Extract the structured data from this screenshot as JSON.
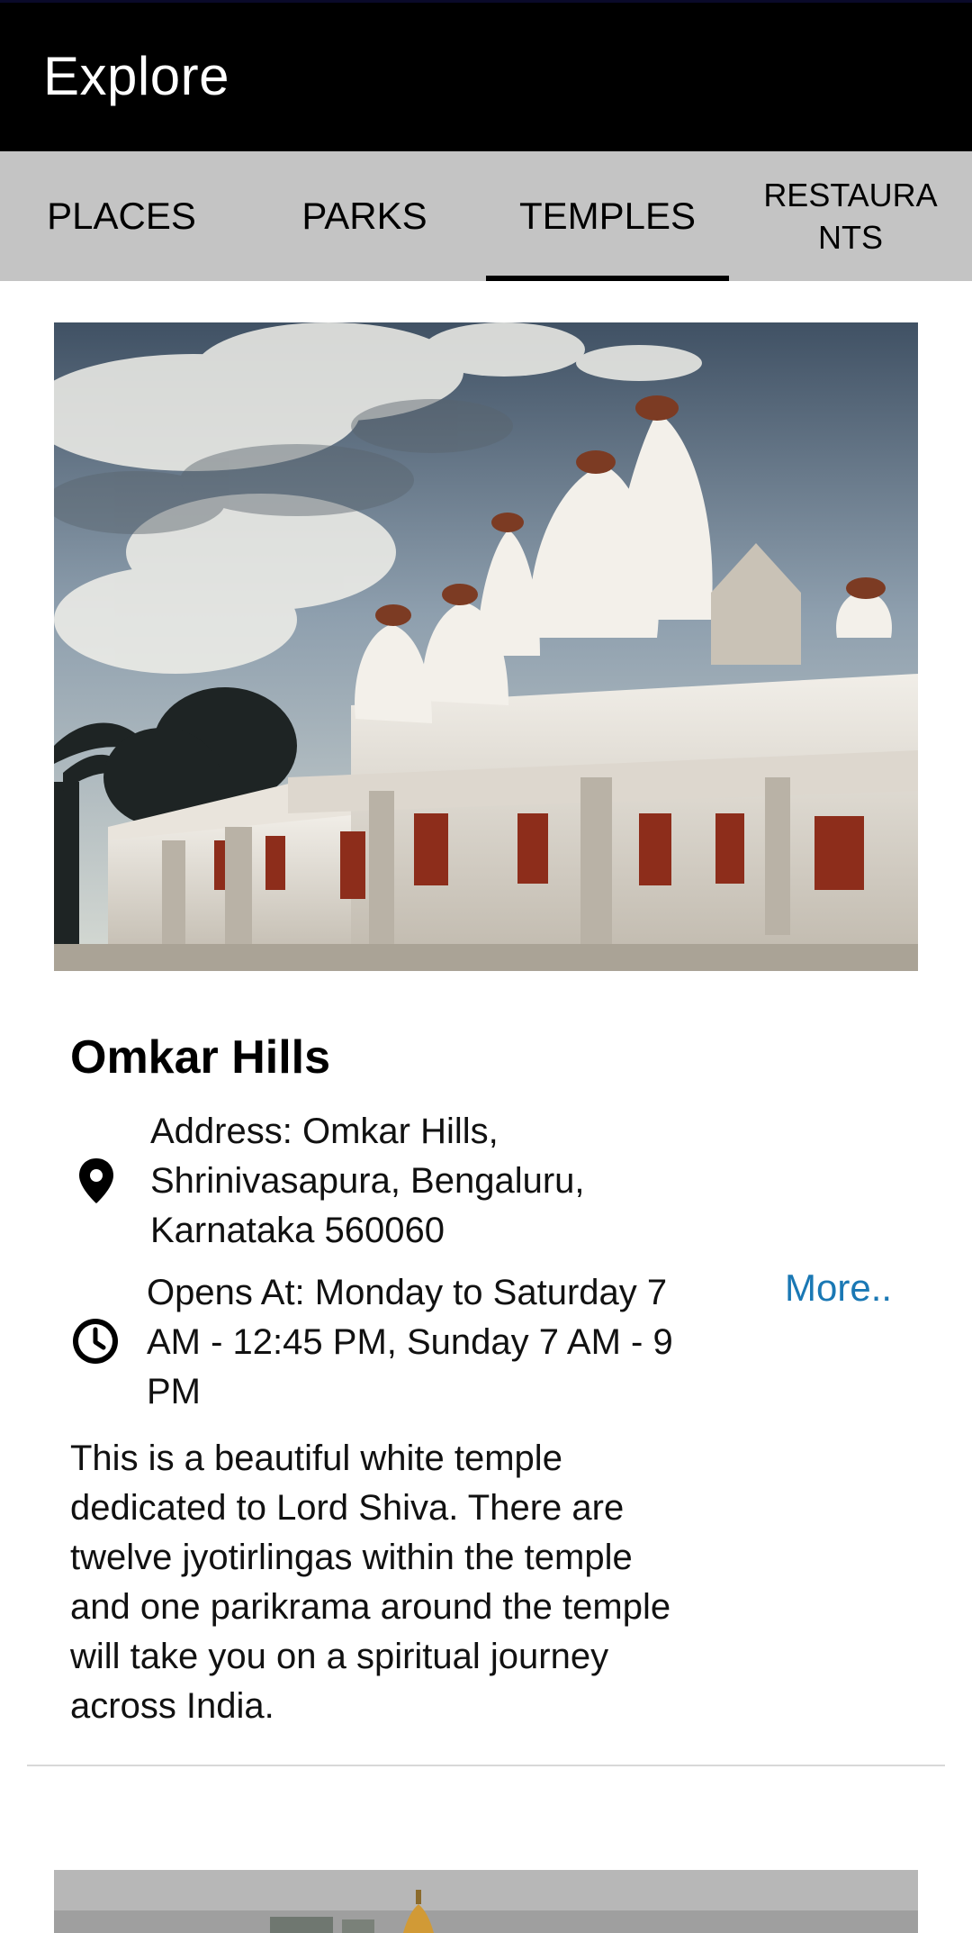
{
  "app_bar": {
    "title": "Explore"
  },
  "tabs": [
    {
      "label": "PLACES",
      "selected": false
    },
    {
      "label": "PARKS",
      "selected": false
    },
    {
      "label": "TEMPLES",
      "selected": true
    },
    {
      "label": "RESTAURA\nNTS",
      "selected": false
    }
  ],
  "cards": [
    {
      "title": "Omkar Hills",
      "address_lines": [
        "Address: Omkar Hills,",
        "Shrinivasapura, Bengaluru,",
        "Karnataka 560060"
      ],
      "hours_lines": [
        "Opens At: Monday to Saturday 7",
        "AM - 12:45 PM, Sunday 7 AM - 9",
        "PM"
      ],
      "more_label": "More..",
      "description_lines": [
        "This is a beautiful white temple",
        "dedicated to Lord Shiva. There are",
        "twelve jyotirlingas within the temple",
        "and one parikrama around the temple",
        "will take you on a spiritual journey",
        "across India."
      ],
      "image": "white-temple-photo"
    }
  ],
  "icons": {
    "address": "location-pin-icon",
    "hours": "clock-icon"
  },
  "colors": {
    "app_bar": "#000000",
    "tab_bar": "#c4c4c4",
    "tab_indicator": "#000000",
    "link": "#1a78b4"
  }
}
